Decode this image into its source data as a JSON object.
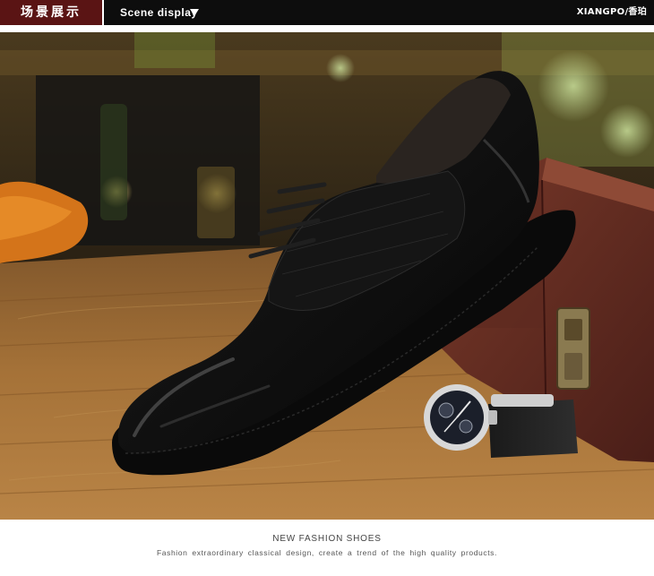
{
  "header": {
    "tab_label": "场景展示",
    "subtitle": "Scene display",
    "brand": "XIANGPO/香珀",
    "arrow_icon": "triangle-down-icon"
  },
  "photo": {
    "subject": "shoe-photo",
    "colors": {
      "shoe": "#0b0b0b",
      "wood": "#9b6a34",
      "box": "#5b2a22",
      "background": "#3a2c16"
    }
  },
  "caption": {
    "title": "NEW FASHION SHOES",
    "text": "Fashion extraordinary classical design, create a trend of the high quality products."
  },
  "colors": {
    "header_bg": "#0d0d0d",
    "tab_bg": "#5a1414",
    "text_main": "#444444"
  }
}
